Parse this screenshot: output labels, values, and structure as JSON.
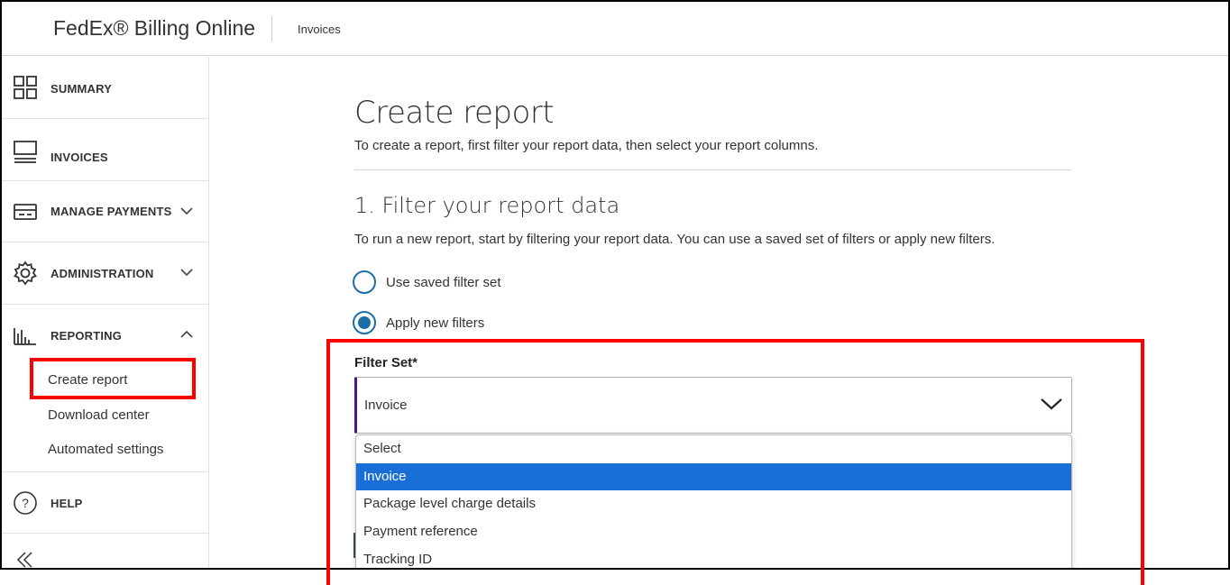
{
  "header": {
    "brand": "FedEx® Billing Online",
    "breadcrumb": "Invoices"
  },
  "sidebar": {
    "items": [
      {
        "label": "SUMMARY",
        "icon": "grid-icon"
      },
      {
        "label": "INVOICES",
        "icon": "invoice-icon"
      },
      {
        "label": "MANAGE PAYMENTS",
        "icon": "card-icon",
        "chevron": "down"
      },
      {
        "label": "ADMINISTRATION",
        "icon": "gear-icon",
        "chevron": "down"
      },
      {
        "label": "REPORTING",
        "icon": "bar-chart-icon",
        "chevron": "up"
      },
      {
        "label": "HELP",
        "icon": "help-icon"
      }
    ],
    "reporting_sub": [
      "Create report",
      "Download center",
      "Automated settings"
    ],
    "collapse_icon": "double-chevron-left-icon"
  },
  "main": {
    "title": "Create report",
    "subtitle": "To create a report, first filter your report data, then select your report columns.",
    "section_title": "1. Filter your report data",
    "section_subtitle": "To run a new report, start by filtering your report data. You can use a saved set of filters or apply new filters.",
    "radio_options": [
      {
        "label": "Use saved filter set",
        "checked": false
      },
      {
        "label": "Apply new filters",
        "checked": true
      }
    ],
    "filter_set": {
      "label": "Filter Set*",
      "value": "Invoice",
      "options": [
        "Select",
        "Invoice",
        "Package level charge details",
        "Payment reference",
        "Tracking ID"
      ],
      "selected_index": 1
    }
  },
  "colors": {
    "accent_blue": "#1a6fa6",
    "highlight_blue": "#1a6fd6",
    "brand_purple": "#4d148c",
    "annotation_red": "#ff0000"
  }
}
